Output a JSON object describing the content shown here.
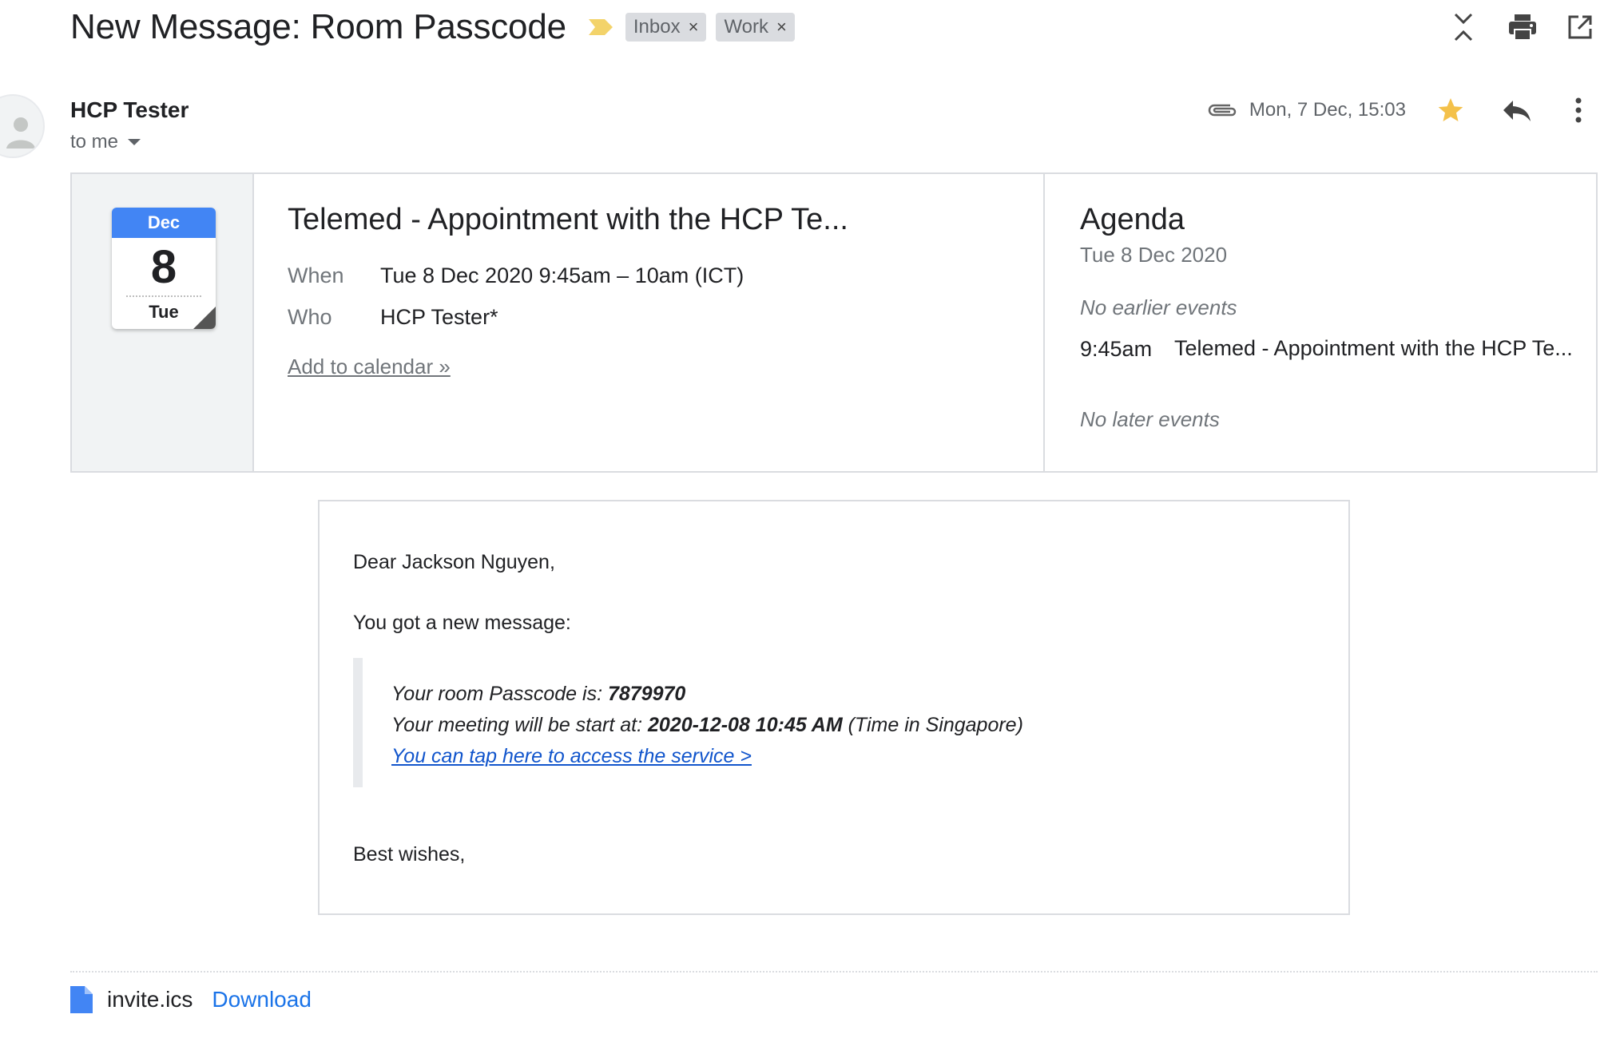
{
  "header": {
    "subject": "New Message: Room Passcode",
    "labels": [
      {
        "name": "Inbox",
        "remove": "×"
      },
      {
        "name": "Work",
        "remove": "×"
      }
    ],
    "icons": [
      "collapse-all-icon",
      "print-icon",
      "open-in-new-window-icon"
    ]
  },
  "sender": {
    "name": "HCP Tester",
    "recipient": "to me",
    "timestamp": "Mon, 7 Dec, 15:03",
    "starred": true,
    "has_attachment": true
  },
  "invite": {
    "calendar_badge": {
      "month": "Dec",
      "day": "8",
      "weekday": "Tue"
    },
    "title": "Telemed - Appointment with the HCP Te...",
    "when_label": "When",
    "when_value": "Tue 8 Dec 2020 9:45am – 10am (ICT)",
    "who_label": "Who",
    "who_value": "HCP Tester*",
    "add_to_calendar": "Add to calendar »",
    "agenda": {
      "title": "Agenda",
      "date": "Tue 8 Dec 2020",
      "no_earlier": "No earlier events",
      "item_time": "9:45am",
      "item_title": "Telemed - Appointment with the HCP Te...",
      "no_later": "No later events"
    }
  },
  "body": {
    "greeting": "Dear Jackson Nguyen,",
    "intro": "You got a new message:",
    "passcode_label": "Your room Passcode is: ",
    "passcode_value": "7879970",
    "start_label": "Your meeting will be start at: ",
    "start_value": "2020-12-08 10:45 AM",
    "start_note": " (Time in Singapore)",
    "service_link": "You can tap here to access the service >",
    "signoff": "Best wishes,"
  },
  "attachment": {
    "file_name": "invite.ics",
    "download_label": "Download"
  },
  "colors": {
    "calendar_blue": "#4285f4",
    "star": "#f4c14a",
    "importance": "#f3d36a",
    "link": "#1155cc",
    "download": "#1a73e8"
  }
}
